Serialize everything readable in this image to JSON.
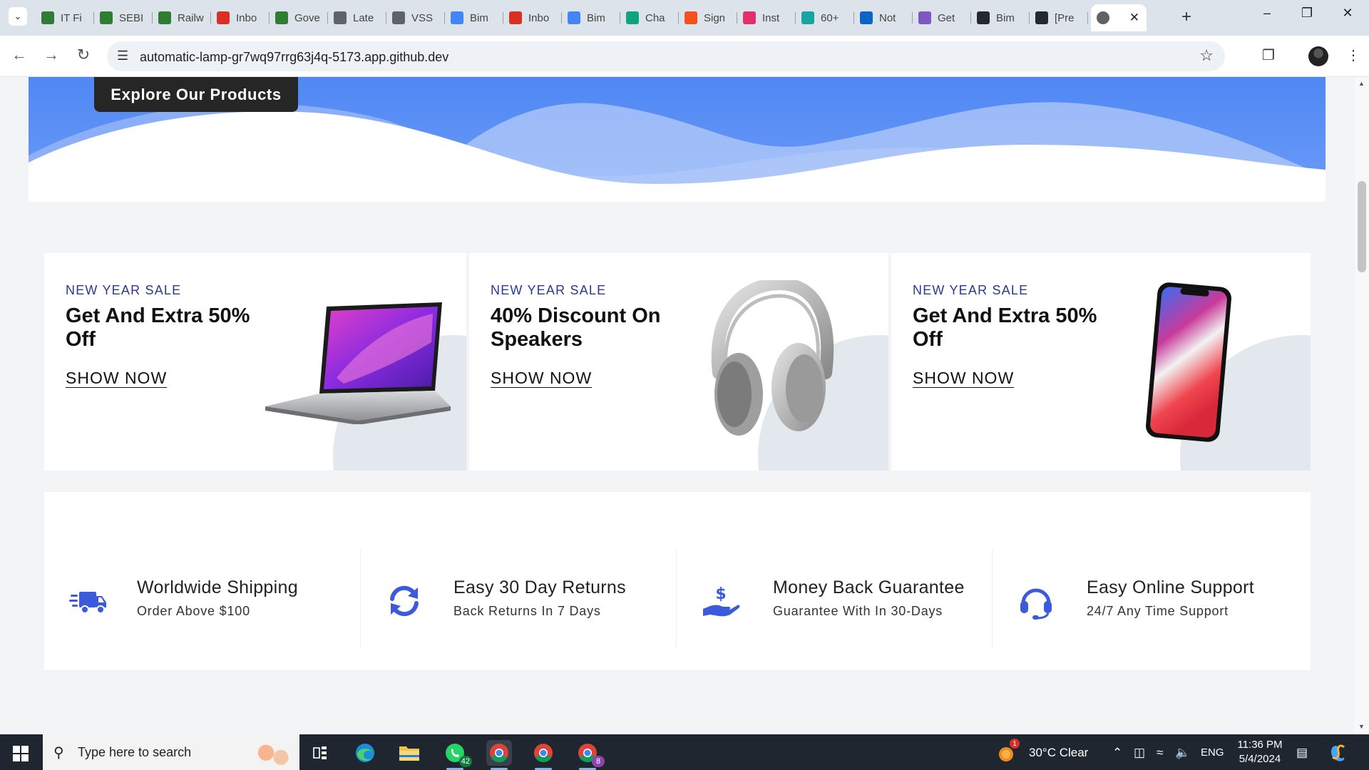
{
  "browser": {
    "tabs": [
      {
        "label": "IT Fi",
        "icon": "college-icon",
        "color": "#2e7d32"
      },
      {
        "label": "SEBI",
        "icon": "college-icon",
        "color": "#2e7d32"
      },
      {
        "label": "Railw",
        "icon": "college-icon",
        "color": "#2e7d32"
      },
      {
        "label": "Inbo",
        "icon": "gmail-icon",
        "color": "#d93025"
      },
      {
        "label": "Gove",
        "icon": "college-icon",
        "color": "#2e7d32"
      },
      {
        "label": "Late",
        "icon": "news-icon",
        "color": "#5f6368"
      },
      {
        "label": "VSS",
        "icon": "news-icon",
        "color": "#5f6368"
      },
      {
        "label": "Bim",
        "icon": "docs-icon",
        "color": "#4285f4"
      },
      {
        "label": "Inbo",
        "icon": "gmail-icon",
        "color": "#d93025"
      },
      {
        "label": "Bim",
        "icon": "docs-icon",
        "color": "#4285f4"
      },
      {
        "label": "Cha",
        "icon": "chatgpt-icon",
        "color": "#10a37f"
      },
      {
        "label": "Sign",
        "icon": "sign-icon",
        "color": "#f4511e"
      },
      {
        "label": "Inst",
        "icon": "instagram-icon",
        "color": "#e1306c"
      },
      {
        "label": "60+",
        "icon": "n-icon",
        "color": "#1aa3a3"
      },
      {
        "label": "Not",
        "icon": "linkedin-icon",
        "color": "#0a66c2"
      },
      {
        "label": "Get",
        "icon": "v-icon",
        "color": "#7e57c2"
      },
      {
        "label": "Bim",
        "icon": "github-icon",
        "color": "#24292f"
      },
      {
        "label": "[Pre",
        "icon": "github-icon",
        "color": "#24292f"
      }
    ],
    "active_tab_icon": "globe-icon",
    "url": "automatic-lamp-gr7wq97rrg63j4q-5173.app.github.dev"
  },
  "hero": {
    "cta_label": "Explore Our Products"
  },
  "promos": [
    {
      "tag": "NEW YEAR SALE",
      "title": "Get And Extra 50% Off",
      "cta": "SHOW NOW",
      "product": "laptop"
    },
    {
      "tag": "NEW YEAR SALE",
      "title": "40% Discount On Speakers",
      "cta": "SHOW NOW",
      "product": "headphones"
    },
    {
      "tag": "NEW YEAR SALE",
      "title": "Get And Extra 50% Off",
      "cta": "SHOW NOW",
      "product": "smartphone"
    }
  ],
  "features": [
    {
      "title": "Worldwide Shipping",
      "subtitle": "Order Above $100",
      "icon": "truck-icon"
    },
    {
      "title": "Easy 30 Day Returns",
      "subtitle": "Back Returns In 7 Days",
      "icon": "refresh-icon"
    },
    {
      "title": "Money Back Guarantee",
      "subtitle": "Guarantee With In 30-Days",
      "icon": "money-hand-icon"
    },
    {
      "title": "Easy Online Support",
      "subtitle": "24/7 Any Time Support",
      "icon": "headset-icon"
    }
  ],
  "colors": {
    "accent": "#3b5bdb",
    "hero_blue": "#4f87f4",
    "tag_blue": "#2b3a8f",
    "dark_button": "#262626"
  },
  "taskbar": {
    "search_placeholder": "Type here to search",
    "whatsapp_badge": "42",
    "chrome_badge": "8",
    "weather": "30°C  Clear",
    "weather_badge": "1",
    "language": "ENG",
    "time": "11:36 PM",
    "date": "5/4/2024"
  }
}
